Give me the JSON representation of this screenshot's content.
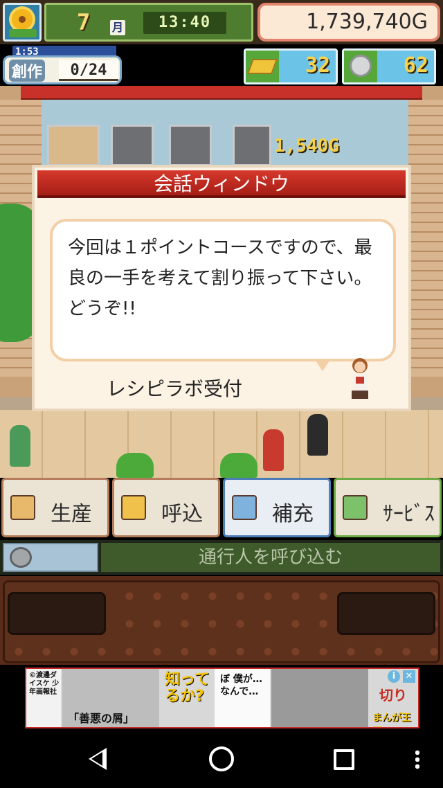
{
  "hud": {
    "month": "7",
    "month_label": "月",
    "time": "13:40",
    "money": "1,739,740G"
  },
  "create": {
    "timer": "1:53",
    "label": "創作",
    "count": "0/24"
  },
  "resources": {
    "gold_bars": "32",
    "medals": "62"
  },
  "scene": {
    "price_tag": "1,540G"
  },
  "dialog": {
    "title": "会話ウィンドウ",
    "message": "今回は１ポイントコースですので、最良の一手を考えて割り振って下さい。どうぞ!!",
    "speaker": "レシピラボ受付"
  },
  "commands": [
    {
      "label": "生産",
      "icon": "bread-icon"
    },
    {
      "label": "呼込",
      "icon": "megaphone-icon"
    },
    {
      "label": "補充",
      "icon": "cake-icon"
    },
    {
      "label": "ｻｰﾋﾞｽ",
      "icon": "teacup-icon"
    }
  ],
  "status": {
    "text": "通行人を呼び込む"
  },
  "ad": {
    "publisher": "©渡邊ダイスケ 少年画報社",
    "quote1": "「善悪の屑」",
    "quote2": "知ってるか?",
    "quote3": "ぼ 僕が… なんで…",
    "quote4": "切り",
    "brand": "まんが王国",
    "info": "i",
    "close": "✕"
  },
  "colors": {
    "dialog_title_bg": "#c62a20",
    "status_bg": "#3f5a2b",
    "money_border": "#e2836b"
  }
}
